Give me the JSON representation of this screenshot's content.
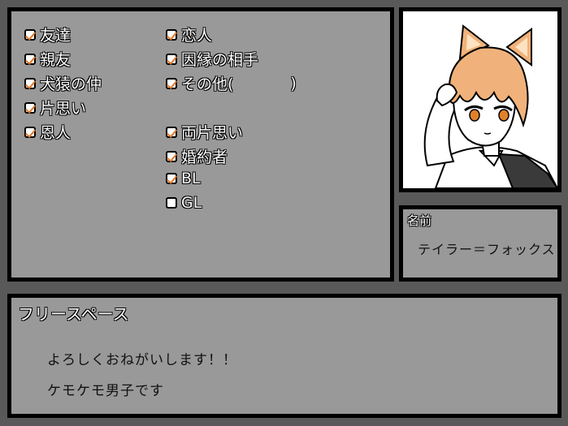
{
  "relations": {
    "left_column": [
      {
        "label": "友達",
        "checked": true
      },
      {
        "label": "親友",
        "checked": true
      },
      {
        "label": "犬猿の仲",
        "checked": true
      },
      {
        "label": "片思い",
        "checked": true
      },
      {
        "label": "恩人",
        "checked": true
      }
    ],
    "right_column_top": [
      {
        "label": "恋人",
        "checked": true
      },
      {
        "label": "因縁の相手",
        "checked": true
      },
      {
        "label": "その他(",
        "checked": true,
        "suffix": ")"
      }
    ],
    "right_column_bottom": [
      {
        "label": "両片思い",
        "checked": true
      },
      {
        "label": "婚約者",
        "checked": true
      },
      {
        "label": "BL",
        "checked": true
      },
      {
        "label": "GL",
        "checked": false
      }
    ]
  },
  "name_section": {
    "title": "名前",
    "value": "テイラー＝フォックス"
  },
  "free_space": {
    "title": "フリースペース",
    "lines": [
      "よろしくおねがいします！！",
      "ケモケモ男子です"
    ]
  },
  "colors": {
    "page_background": "#595959",
    "panel_background": "#999999",
    "border": "#000000",
    "check_mark": "#e07a2e",
    "hair": "#f0b27a",
    "eyes": "#e0812a"
  },
  "portrait": {
    "icon": "fox-eared-boy-illustration"
  }
}
